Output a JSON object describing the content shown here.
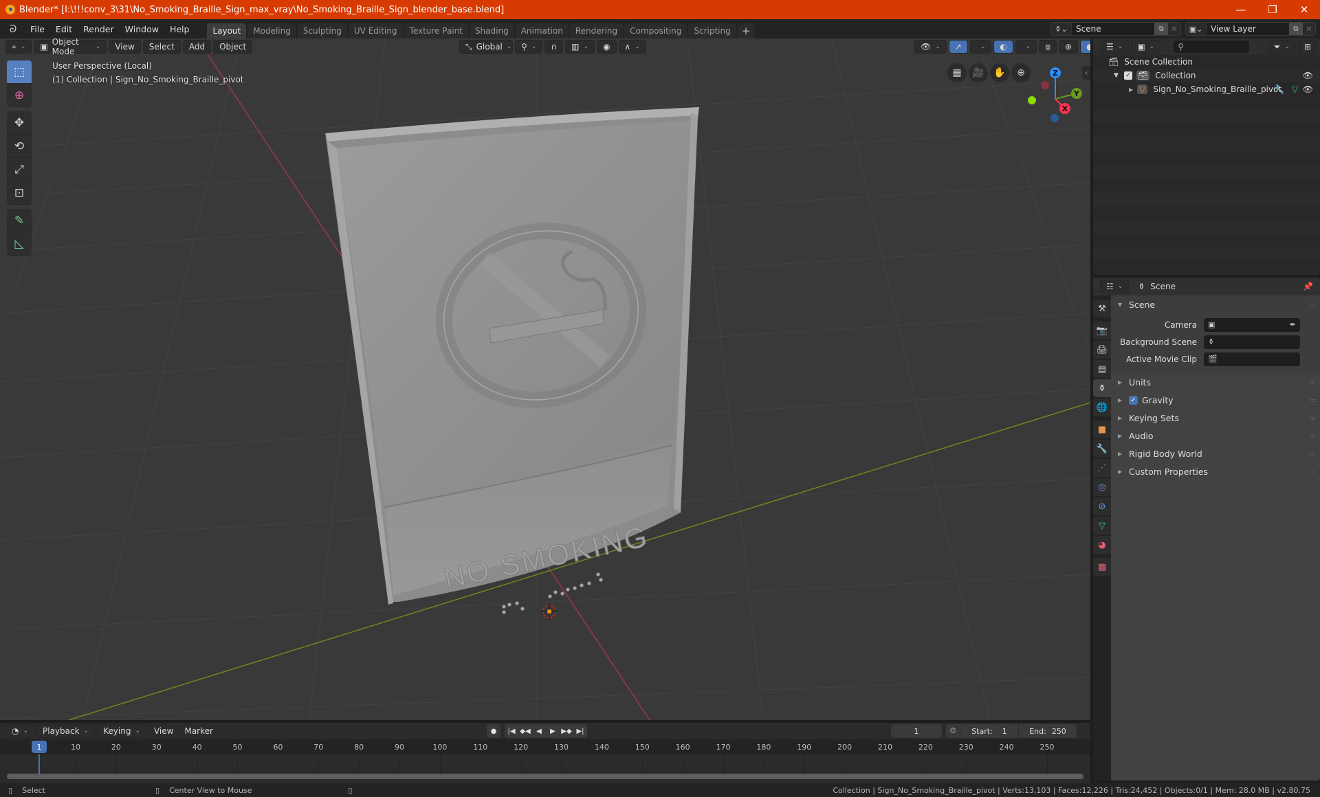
{
  "window": {
    "title": "Blender* [I:\\!!!conv_3\\31\\No_Smoking_Braille_Sign_max_vray\\No_Smoking_Braille_Sign_blender_base.blend]",
    "minimize": "—",
    "maximize": "❐",
    "close": "✕"
  },
  "menu": [
    "File",
    "Edit",
    "Render",
    "Window",
    "Help"
  ],
  "workspaces": [
    {
      "label": "Layout",
      "active": true
    },
    {
      "label": "Modeling"
    },
    {
      "label": "Sculpting"
    },
    {
      "label": "UV Editing"
    },
    {
      "label": "Texture Paint"
    },
    {
      "label": "Shading"
    },
    {
      "label": "Animation"
    },
    {
      "label": "Rendering"
    },
    {
      "label": "Compositing"
    },
    {
      "label": "Scripting"
    }
  ],
  "add_workspace": "+",
  "scene_selector": {
    "value": "Scene"
  },
  "view_layer_selector": {
    "value": "View Layer"
  },
  "viewport": {
    "mode": "Object Mode",
    "menus": [
      "View",
      "Select",
      "Add",
      "Object"
    ],
    "orientation": "Global",
    "info_line1": "User Perspective (Local)",
    "info_line2": "(1) Collection | Sign_No_Smoking_Braille_pivot",
    "shading_active": "solid",
    "gizmo_axes": {
      "x": "X",
      "y": "Y",
      "z": "Z"
    },
    "colors": {
      "x_axis": "#ff3352",
      "y_axis": "#8bdc00",
      "z_axis": "#2890ff",
      "grid_bg": "#393939"
    },
    "sign_text": "NO SMOKING"
  },
  "outliner": {
    "search_placeholder": "",
    "items": [
      {
        "label": "Scene Collection",
        "level": 0
      },
      {
        "label": "Collection",
        "level": 1,
        "checked": true
      },
      {
        "label": "Sign_No_Smoking_Braille_pivot",
        "level": 2
      }
    ]
  },
  "properties": {
    "context": "Scene",
    "panels": [
      {
        "label": "Scene",
        "expanded": true
      },
      {
        "label": "Units"
      },
      {
        "label": "Gravity",
        "checkbox": true
      },
      {
        "label": "Keying Sets"
      },
      {
        "label": "Audio"
      },
      {
        "label": "Rigid Body World"
      },
      {
        "label": "Custom Properties"
      }
    ],
    "fields": [
      {
        "label": "Camera",
        "value": ""
      },
      {
        "label": "Background Scene",
        "value": ""
      },
      {
        "label": "Active Movie Clip",
        "value": ""
      }
    ]
  },
  "timeline": {
    "menus": [
      "Playback",
      "Keying",
      "View",
      "Marker"
    ],
    "current_frame": "1",
    "start_label": "Start:",
    "start": "1",
    "end_label": "End:",
    "end": "250",
    "ticks": [
      "10",
      "20",
      "30",
      "40",
      "50",
      "60",
      "70",
      "80",
      "90",
      "100",
      "110",
      "120",
      "130",
      "140",
      "150",
      "160",
      "170",
      "180",
      "190",
      "200",
      "210",
      "220",
      "230",
      "240",
      "250"
    ]
  },
  "statusbar": {
    "left_hint": "Select",
    "middle_hint": "Center View to Mouse",
    "stats": "Collection | Sign_No_Smoking_Braille_pivot | Verts:13,103 | Faces:12,226 | Tris:24,452 | Objects:0/1 | Mem: 28.0 MB | v2.80.75"
  }
}
